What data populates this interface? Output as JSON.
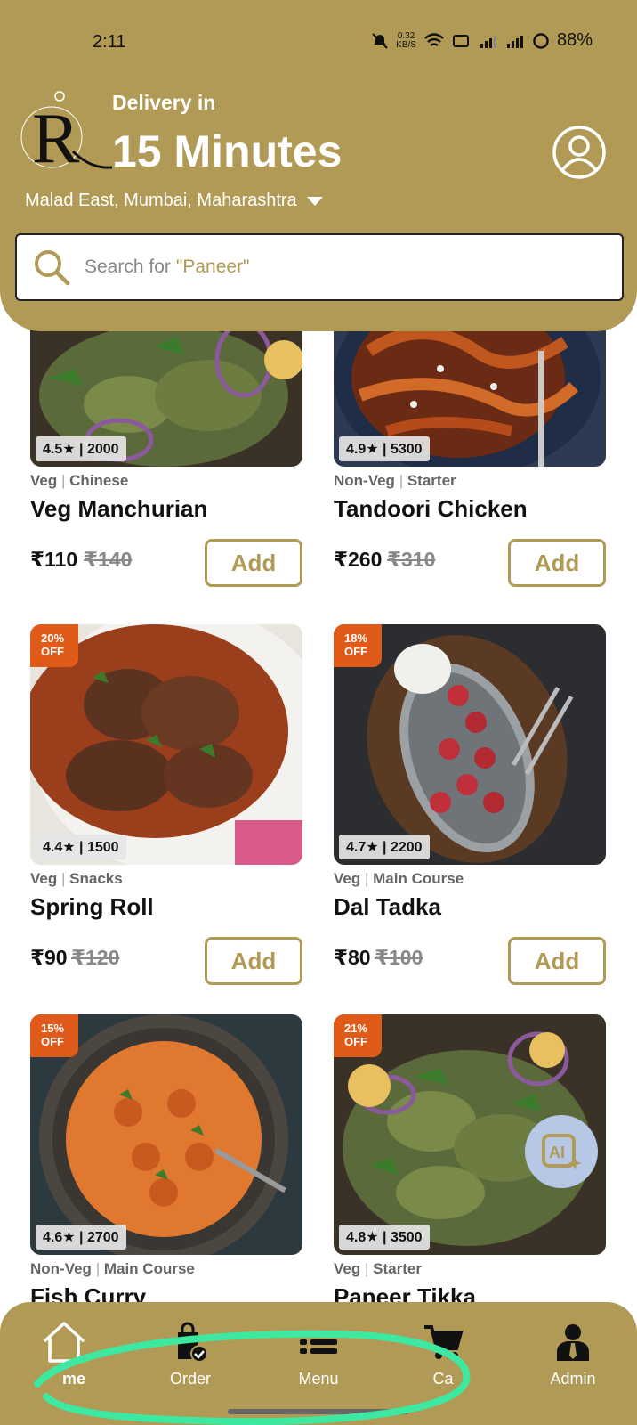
{
  "status_bar": {
    "time": "2:11",
    "speed_value": "0.32",
    "speed_unit": "KB/S",
    "battery": "88%"
  },
  "header": {
    "delivery_label": "Delivery in",
    "delivery_time": "15 Minutes",
    "location": "Malad East, Mumbai, Maharashtra",
    "accent_color": "#b19a55"
  },
  "search": {
    "prefix": "Search for",
    "term": "\"Paneer\""
  },
  "items": [
    {
      "rating": "4.5★ | 2000",
      "type": "Veg",
      "category": "Chinese",
      "name": "Veg Manchurian",
      "price": "₹110",
      "old_price": "₹140",
      "discount": "",
      "add_label": "Add"
    },
    {
      "rating": "4.9★ | 5300",
      "type": "Non-Veg",
      "category": "Starter",
      "name": "Tandoori Chicken",
      "price": "₹260",
      "old_price": "₹310",
      "discount": "",
      "add_label": "Add"
    },
    {
      "rating": "4.4★ | 1500",
      "type": "Veg",
      "category": "Snacks",
      "name": "Spring Roll",
      "price": "₹90",
      "old_price": "₹120",
      "discount": "20% OFF",
      "add_label": "Add"
    },
    {
      "rating": "4.7★ | 2200",
      "type": "Veg",
      "category": "Main Course",
      "name": "Dal Tadka",
      "price": "₹80",
      "old_price": "₹100",
      "discount": "18% OFF",
      "add_label": "Add"
    },
    {
      "rating": "4.6★ | 2700",
      "type": "Non-Veg",
      "category": "Main Course",
      "name": "Fish Curry",
      "price": "",
      "old_price": "",
      "discount": "15% OFF",
      "add_label": "Add"
    },
    {
      "rating": "4.8★ | 3500",
      "type": "Veg",
      "category": "Starter",
      "name": "Paneer Tikka",
      "price": "",
      "old_price": "",
      "discount": "21% OFF",
      "add_label": "Add"
    }
  ],
  "ai_button": {
    "icon": "ai-sparkle-icon"
  },
  "nav": {
    "home": "me",
    "order": "Order",
    "menu": "Menu",
    "cart": "Ca",
    "admin": "Admin"
  }
}
